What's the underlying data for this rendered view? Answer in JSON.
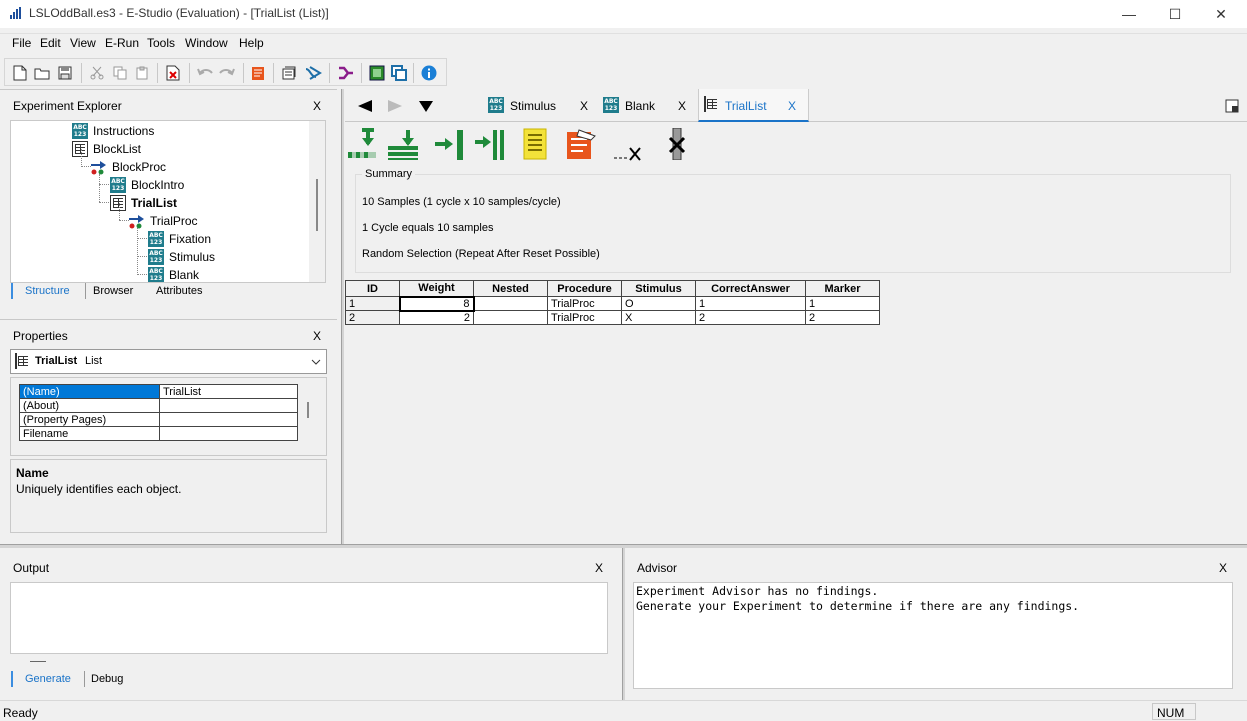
{
  "window": {
    "title": "LSLOddBall.es3 - E-Studio (Evaluation) - [TrialList  (List)]",
    "minimize": "—",
    "maximize": "☐",
    "close": "✕"
  },
  "menu": {
    "items": [
      "File",
      "Edit",
      "View",
      "E-Run",
      "Tools",
      "Window",
      "Help"
    ]
  },
  "explorer": {
    "title": "Experiment Explorer",
    "close": "X",
    "tree": [
      {
        "label": "Instructions",
        "type": "abc"
      },
      {
        "label": "BlockList",
        "type": "list"
      },
      {
        "label": "BlockProc",
        "type": "proc"
      },
      {
        "label": "BlockIntro",
        "type": "abc"
      },
      {
        "label": "TrialList",
        "type": "list",
        "selected": true
      },
      {
        "label": "TrialProc",
        "type": "proc"
      },
      {
        "label": "Fixation",
        "type": "abc"
      },
      {
        "label": "Stimulus",
        "type": "abc"
      },
      {
        "label": "Blank",
        "type": "abc"
      }
    ],
    "tabs": [
      "Structure",
      "Browser",
      "Attributes"
    ]
  },
  "properties": {
    "title": "Properties",
    "close": "X",
    "object_name": "TrialList",
    "object_type": "List",
    "rows": [
      {
        "name": "(Name)",
        "value": "TrialList"
      },
      {
        "name": "(About)",
        "value": ""
      },
      {
        "name": "(Property Pages)",
        "value": ""
      },
      {
        "name": "Filename",
        "value": ""
      }
    ],
    "desc_title": "Name",
    "desc_text": "Uniquely identifies each object."
  },
  "doc_tabs": {
    "items": [
      {
        "label": "Stimulus",
        "close": "X",
        "active": false
      },
      {
        "label": "Blank",
        "close": "X",
        "active": false
      },
      {
        "label": "TrialList",
        "close": "X",
        "active": true
      }
    ]
  },
  "summary": {
    "title": "Summary",
    "lines": [
      "10 Samples (1 cycle x 10 samples/cycle)",
      "1 Cycle equals 10 samples",
      "Random Selection  (Repeat After Reset Possible)"
    ]
  },
  "list_table": {
    "columns": [
      "ID",
      "Weight",
      "Nested",
      "Procedure",
      "Stimulus",
      "CorrectAnswer",
      "Marker"
    ],
    "rows": [
      [
        "1",
        "8",
        "",
        "TrialProc",
        "O",
        "1",
        "1"
      ],
      [
        "2",
        "2",
        "",
        "TrialProc",
        "X",
        "2",
        "2"
      ]
    ]
  },
  "output": {
    "title": "Output",
    "close": "X",
    "tabs": [
      "Generate",
      "Debug"
    ]
  },
  "advisor": {
    "title": "Advisor",
    "close": "X",
    "lines": [
      "Experiment Advisor has no findings.",
      "Generate your Experiment to determine if there are any findings."
    ]
  },
  "statusbar": {
    "text": "Ready",
    "num": "NUM"
  }
}
